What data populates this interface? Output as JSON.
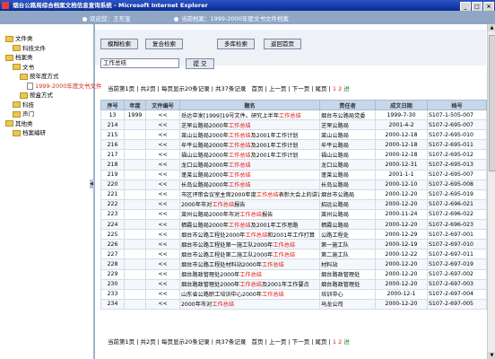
{
  "window": {
    "title": "烟台公路局综合档案文档信息查询系统 - Microsoft Internet Explorer"
  },
  "userbar": {
    "user_label": "欢迎您：王东宝",
    "current_label": "当前档案：1999-2000年度文书文件档案"
  },
  "tree": [
    {
      "label": "文件类",
      "kind": "folder",
      "level": 0
    },
    {
      "label": "科技文件",
      "kind": "folder",
      "level": 1
    },
    {
      "label": "档案类",
      "kind": "folder",
      "level": 0
    },
    {
      "label": "文书",
      "kind": "folder",
      "level": 1
    },
    {
      "label": "按年度方式",
      "kind": "folder",
      "level": 2
    },
    {
      "label": "1999-2000年度文书文件",
      "kind": "doc",
      "level": 3,
      "selected": true
    },
    {
      "label": "按盒方式",
      "kind": "folder",
      "level": 2
    },
    {
      "label": "科技",
      "kind": "folder",
      "level": 1
    },
    {
      "label": "声门",
      "kind": "folder",
      "level": 1
    },
    {
      "label": "其他类",
      "kind": "folder",
      "level": 0
    },
    {
      "label": "档案编研",
      "kind": "folder",
      "level": 1
    }
  ],
  "toolbar": {
    "fuzzy": "模糊检索",
    "compound": "复合检索",
    "multi": "多库检索",
    "home": "返回首页"
  },
  "search": {
    "value": "工作总结",
    "submit": "提 交"
  },
  "pager": {
    "current": "当前第1页",
    "total_pages": "共2页",
    "per_page": "每页显示20条记录",
    "total_records": "共37条记录",
    "first": "首页",
    "prev": "上一页",
    "next": "下一页",
    "last": "尾页",
    "page_a": "1",
    "page_b": "2",
    "go": "进"
  },
  "columns": [
    "序号",
    "年度",
    "文件编号",
    "题名",
    "责任者",
    "成文日期",
    "档号"
  ],
  "rows": [
    {
      "no": "13",
      "year": "1999",
      "code": "<<",
      "pre": "岳达中发[1999]19号文件。研究上半年",
      "hl": "工作总结",
      "post": "",
      "author": "烟台市公路局党委",
      "date": "1999-7-30",
      "id": "S107-1-505-007"
    },
    {
      "no": "214",
      "year": "",
      "code": "<<",
      "pre": "芝罘公路局2000年",
      "hl": "工作总结",
      "post": "",
      "author": "芝罘公路局",
      "date": "2001-4-2",
      "id": "S107-2-695-007"
    },
    {
      "no": "215",
      "year": "",
      "code": "<<",
      "pre": "莱山公路局2000年",
      "hl": "工作总结",
      "post": "及2001年工作计划",
      "author": "莱山公路局",
      "date": "2000-12-18",
      "id": "S107-2-695-010"
    },
    {
      "no": "216",
      "year": "",
      "code": "<<",
      "pre": "牟平公路局2000年",
      "hl": "工作总结",
      "post": "及2001年工作计划",
      "author": "牟平公路局",
      "date": "2000-12-18",
      "id": "S107-2-695-011"
    },
    {
      "no": "217",
      "year": "",
      "code": "<<",
      "pre": "福山公路局2000年",
      "hl": "工作总结",
      "post": "及2001年工作计划",
      "author": "福山公路局",
      "date": "2000-12-18",
      "id": "S107-2-695-012"
    },
    {
      "no": "218",
      "year": "",
      "code": "<<",
      "pre": "龙口公路局2000年",
      "hl": "工作总结",
      "post": "",
      "author": "龙口公路局",
      "date": "2000-12-31",
      "id": "S107-2-695-013"
    },
    {
      "no": "219",
      "year": "",
      "code": "<<",
      "pre": "蓬莱公路局2000年",
      "hl": "工作总结",
      "post": "",
      "author": "蓬莱公路局",
      "date": "2001-1-1",
      "id": "S107-2-695-007"
    },
    {
      "no": "220",
      "year": "",
      "code": "<<",
      "pre": "长岛公路局2000年",
      "hl": "工作总结",
      "post": "",
      "author": "长岛公路局",
      "date": "2000-12-10",
      "id": "S107-2-695-008"
    },
    {
      "no": "221",
      "year": "",
      "code": "<<",
      "pre": "市区评审会议室主席2000年度",
      "hl": "工作总结",
      "post": "表彰大会上的讲话",
      "author": "烟台市公路局",
      "date": "2000-12-20",
      "id": "S107-2-695-019"
    },
    {
      "no": "222",
      "year": "",
      "code": "<<",
      "pre": "2000年市对",
      "hl": "工作总结",
      "post": "报告",
      "author": "招远公路局",
      "date": "2000-12-20",
      "id": "S107-2-696-021"
    },
    {
      "no": "223",
      "year": "",
      "code": "<<",
      "pre": "莱州公路局2000年市对",
      "hl": "工作总结",
      "post": "报告",
      "author": "莱州公路局",
      "date": "2000-11-24",
      "id": "S107-2-696-022"
    },
    {
      "no": "224",
      "year": "",
      "code": "<<",
      "pre": "栖霞公路局2000年",
      "hl": "工作总结",
      "post": "及2001年工作思路",
      "author": "栖霞公路局",
      "date": "2000-12-20",
      "id": "S107-2-696-023"
    },
    {
      "no": "225",
      "year": "",
      "code": "<<",
      "pre": "烟台市公路工程处2000年",
      "hl": "工作总结",
      "post": "和2001年工作打算",
      "author": "公路工程处",
      "date": "2000-12-29",
      "id": "S107-2-697-001"
    },
    {
      "no": "226",
      "year": "",
      "code": "<<",
      "pre": "烟台市公路工程处第一施工队2000年",
      "hl": "工作总结",
      "post": "",
      "author": "第一施工队",
      "date": "2000-12-19",
      "id": "S107-2-697-010"
    },
    {
      "no": "227",
      "year": "",
      "code": "<<",
      "pre": "烟台市公路工程处第二施工队2000年",
      "hl": "工作总结",
      "post": "",
      "author": "第二施工队",
      "date": "2000-12-22",
      "id": "S107-2-697-011"
    },
    {
      "no": "228",
      "year": "",
      "code": "<<",
      "pre": "烟台市公路工程处材料站2000年",
      "hl": "工作总结",
      "post": "",
      "author": "材料站",
      "date": "2000-12-20",
      "id": "S107-2-697-019"
    },
    {
      "no": "229",
      "year": "",
      "code": "<<",
      "pre": "烟台路政管理处2000年",
      "hl": "工作总结",
      "post": "",
      "author": "烟台路政管理处",
      "date": "2000-12-20",
      "id": "S107-2-697-002"
    },
    {
      "no": "230",
      "year": "",
      "code": "<<",
      "pre": "烟台路政管理处2000年",
      "hl": "工作总结",
      "post": "及2001年工作要点",
      "author": "烟台路政管理处",
      "date": "2000-12-20",
      "id": "S107-2-697-003"
    },
    {
      "no": "233",
      "year": "",
      "code": "<<",
      "pre": "山东省公路职工培训中心2000年",
      "hl": "工作总结",
      "post": "",
      "author": "培训中心",
      "date": "2000-12-1",
      "id": "S107-2-697-004"
    },
    {
      "no": "234",
      "year": "",
      "code": "<<",
      "pre": "2000年市对",
      "hl": "工作总结",
      "post": "",
      "author": "马龙公司",
      "date": "2000-12-20",
      "id": "S107-2-697-005"
    }
  ],
  "colors": {
    "highlight": "#e01818",
    "header_bg": "#c7d7ea",
    "titlebar": "#0a2a90"
  }
}
